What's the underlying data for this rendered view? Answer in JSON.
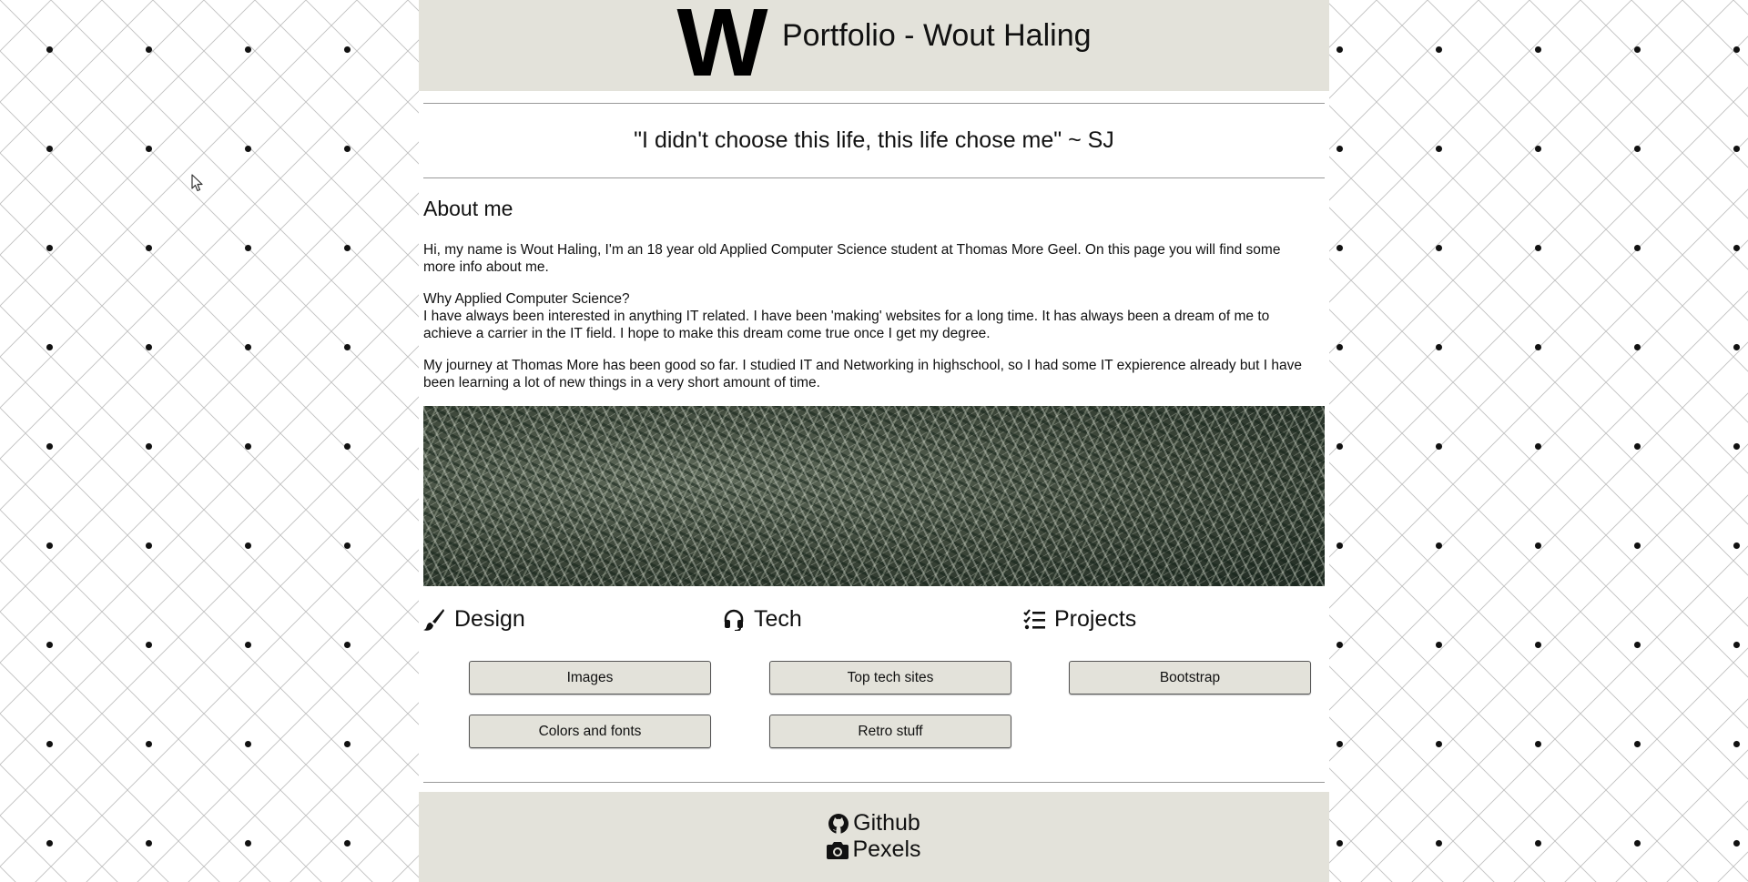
{
  "header": {
    "logo_letter": "W",
    "title": "Portfolio - Wout Haling"
  },
  "quote": "\"I didn't choose this life, this life chose me\" ~ SJ",
  "about": {
    "title": "About me",
    "paragraphs": [
      [
        "Hi, my name is Wout Haling, I'm an 18 year old Applied Computer Science student at Thomas More Geel. On this page you will find some",
        "more info about me."
      ],
      [
        "Why Applied Computer Science?",
        "I have always been interested in anything IT related. I have been 'making' websites for a long time. It has always been a dream of me to",
        "achieve a carrier in the IT field. I hope to make this dream come true once I get my degree."
      ],
      [
        "My journey at Thomas More has been good so far. I studied IT and Networking in highschool, so I had some IT expierence already but I have",
        "been learning a lot of new things in a very short amount of time."
      ]
    ]
  },
  "sections": {
    "design": {
      "title": "Design",
      "icon": "paintbrush-icon",
      "buttons": [
        "Images",
        "Colors and fonts"
      ]
    },
    "tech": {
      "title": "Tech",
      "icon": "headset-icon",
      "buttons": [
        "Top tech sites",
        "Retro stuff"
      ]
    },
    "projects": {
      "title": "Projects",
      "icon": "tasks-list-icon",
      "buttons": [
        "Bootstrap"
      ]
    }
  },
  "footer": {
    "links": [
      {
        "label": "Github",
        "icon": "github-icon"
      },
      {
        "label": "Pexels",
        "icon": "camera-icon"
      }
    ]
  },
  "colors": {
    "header_bg": "#e3e2da",
    "button_bg": "#e3e2da",
    "text": "#111111",
    "rule": "#999999"
  }
}
